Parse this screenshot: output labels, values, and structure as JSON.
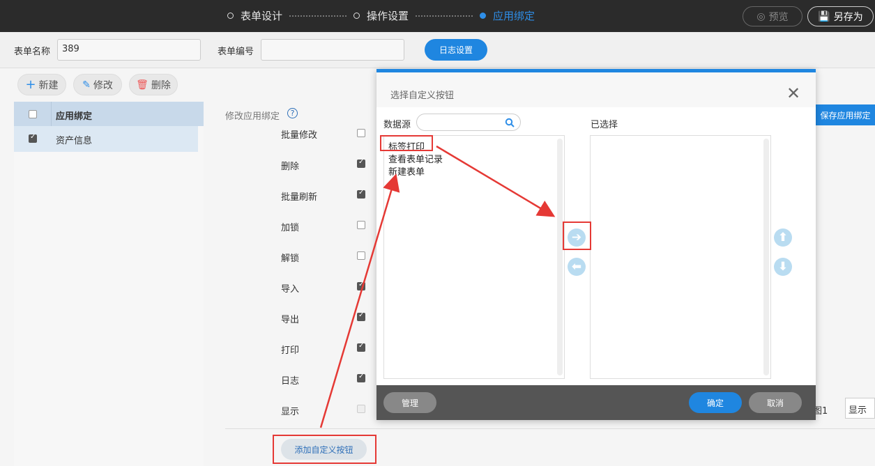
{
  "header": {
    "steps": [
      {
        "label": "表单设计"
      },
      {
        "label": "操作设置"
      },
      {
        "label": "应用绑定"
      }
    ],
    "preview_label": "预览",
    "saveas_label": "另存为"
  },
  "form": {
    "name_label": "表单名称",
    "name_value": "389",
    "code_label": "表单编号",
    "code_value": "",
    "log_button": "日志设置"
  },
  "toolbar": {
    "new_label": "新建",
    "edit_label": "修改",
    "delete_label": "删除"
  },
  "left_list": {
    "header": "应用绑定",
    "rows": [
      {
        "label": "资产信息",
        "checked": true
      }
    ]
  },
  "middle": {
    "title": "修改应用绑定",
    "help_icon": "help-icon",
    "buttons": [
      {
        "label": "批量修改",
        "checked": false
      },
      {
        "label": "删除",
        "checked": true
      },
      {
        "label": "批量刷新",
        "checked": true
      },
      {
        "label": "加锁",
        "checked": false
      },
      {
        "label": "解锁",
        "checked": false
      },
      {
        "label": "导入",
        "checked": true
      },
      {
        "label": "导出",
        "checked": true
      },
      {
        "label": "打印",
        "checked": true
      },
      {
        "label": "日志",
        "checked": true
      },
      {
        "label": "显示",
        "checked": false
      }
    ],
    "add_custom_button": "添加自定义按钮",
    "save_binding_button": "保存应用绑定",
    "fig_label": "图1",
    "display_select": "显示"
  },
  "dialog": {
    "title": "选择自定义按钮",
    "source_label": "数据源",
    "search_placeholder": "",
    "selected_label": "已选择",
    "source_items": [
      "标签打印",
      "查看表单记录",
      "新建表单"
    ],
    "selected_items": [],
    "manage_button": "管理",
    "ok_button": "确定",
    "cancel_button": "取消"
  },
  "colors": {
    "accent": "#1f86e0",
    "annotation": "#e53935",
    "topbar": "#2b2b2b"
  }
}
